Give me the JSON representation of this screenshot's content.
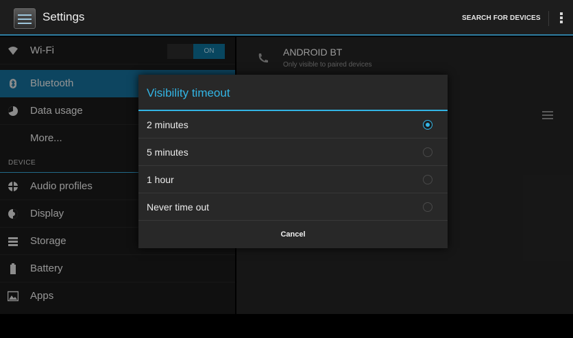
{
  "action_bar": {
    "title": "Settings",
    "search_label": "SEARCH FOR DEVICES"
  },
  "sidebar": {
    "items": [
      {
        "label": "Wi-Fi",
        "icon": "wifi-icon"
      },
      {
        "label": "Bluetooth",
        "icon": "bluetooth-icon",
        "selected": true
      },
      {
        "label": "Data usage",
        "icon": "data-usage-icon"
      },
      {
        "label": "More...",
        "icon": ""
      }
    ],
    "wifi_toggle": "ON",
    "section_device": "DEVICE",
    "device_items": [
      {
        "label": "Audio profiles",
        "icon": "audio-profiles-icon"
      },
      {
        "label": "Display",
        "icon": "display-icon"
      },
      {
        "label": "Storage",
        "icon": "storage-icon"
      },
      {
        "label": "Battery",
        "icon": "battery-icon"
      },
      {
        "label": "Apps",
        "icon": "apps-icon"
      }
    ]
  },
  "detail": {
    "device_name": "ANDROID BT",
    "device_visibility": "Only visible to paired devices"
  },
  "dialog": {
    "title": "Visibility timeout",
    "options": [
      {
        "label": "2 minutes",
        "checked": true
      },
      {
        "label": "5 minutes",
        "checked": false
      },
      {
        "label": "1 hour",
        "checked": false
      },
      {
        "label": "Never time out",
        "checked": false
      }
    ],
    "cancel": "Cancel"
  },
  "colors": {
    "accent": "#33b5e5",
    "selected_item": "#156b94",
    "toggle_on": "#0d6c93"
  }
}
